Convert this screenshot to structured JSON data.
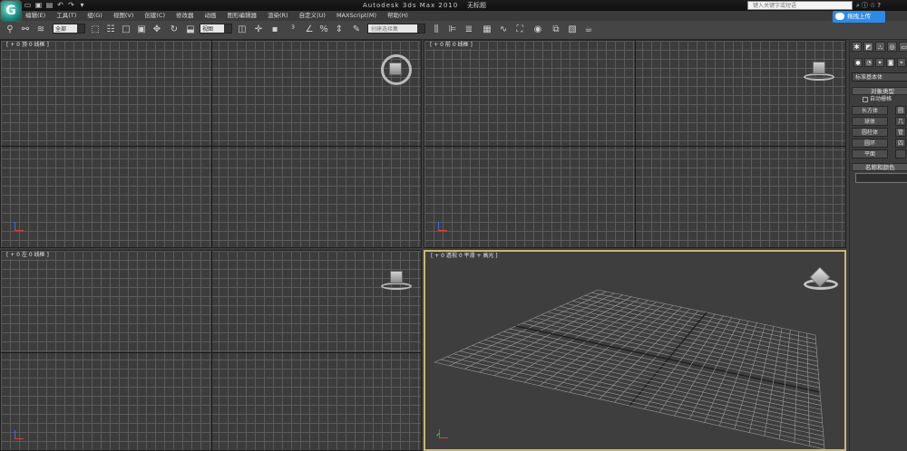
{
  "titlebar": {
    "logo_label": "G",
    "app_title": "Autodesk 3ds Max  2010",
    "doc_title": "无标题",
    "search_placeholder": "键入关键字或短语"
  },
  "upload_button": "拖拽上传",
  "menus": [
    "编辑(E)",
    "工具(T)",
    "组(G)",
    "视图(V)",
    "创建(C)",
    "修改器",
    "动画",
    "图形编辑器",
    "渲染(R)",
    "自定义(U)",
    "MAXScript(M)",
    "帮助(H)"
  ],
  "toolbar": {
    "selection_filter": "全部",
    "view_dropdown": "视图",
    "named_selection_placeholder": "创建选择集"
  },
  "viewports": {
    "top_label": "[ + 0 顶 0 线框 ]",
    "front_label": "[ + 0 前 0 线框 ]",
    "left_label": "[ + 0 左 0 线框 ]",
    "persp_label": "[ + 0 透视 0 平滑 + 高光 ]"
  },
  "command_panel": {
    "category": "标准基本体",
    "object_type_header": "对象类型",
    "autogrid_label": "自动栅格",
    "buttons": [
      "长方体",
      "球体",
      "圆柱体",
      "圆环",
      "平面"
    ],
    "buttons_right": [
      "圆",
      "几",
      "管",
      "四",
      ""
    ],
    "name_color_header": "名称和颜色"
  },
  "colors": {
    "viewport_bg": "#3c3c3c",
    "grid_line": "#5b5b5b",
    "active_viewport_border": "#c8b770",
    "upload_blue": "#2c8be8"
  }
}
